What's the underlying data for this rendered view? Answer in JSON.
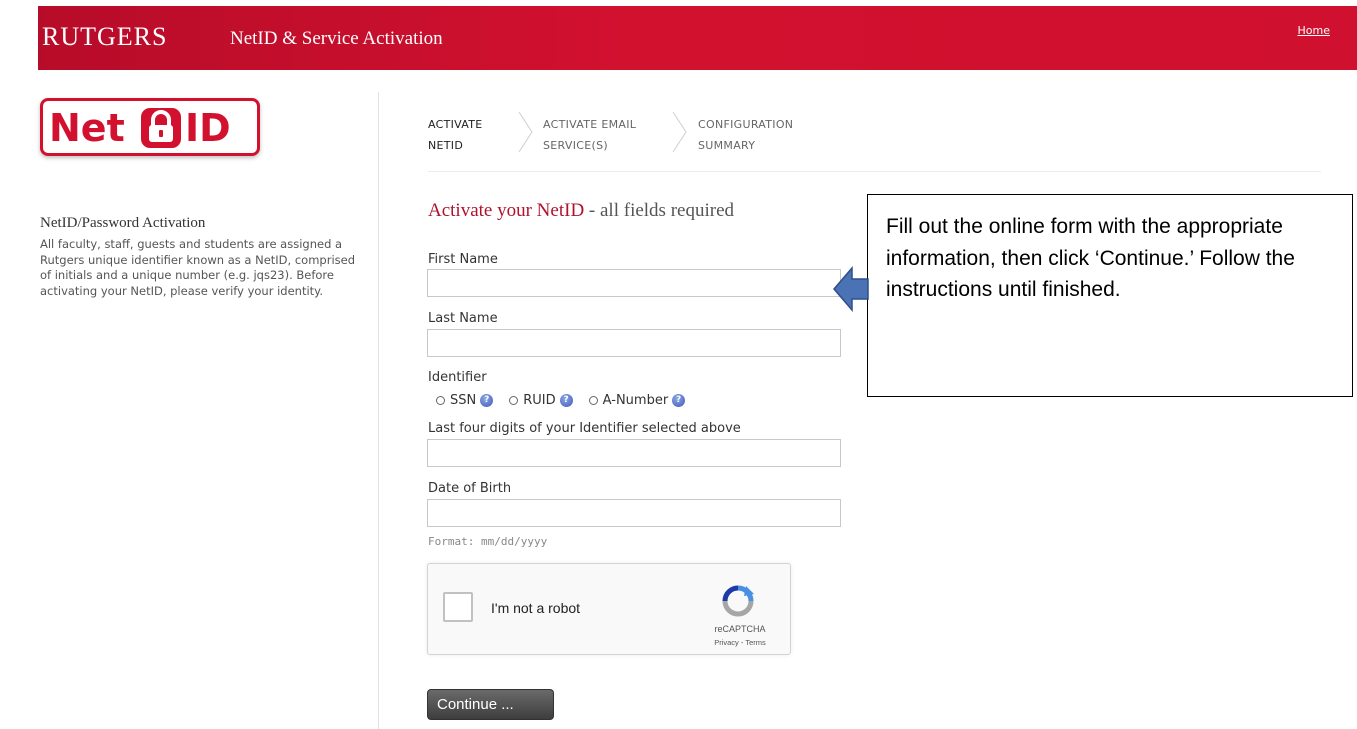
{
  "header": {
    "brand": "RUTGERS",
    "title": "NetID & Service Activation",
    "home_link": "Home"
  },
  "logo": {
    "text_left": "Net",
    "text_right": "ID"
  },
  "sidebar": {
    "title": "NetID/Password Activation",
    "description": "All faculty, staff, guests and students are assigned a Rutgers unique identifier known as a NetID, comprised of initials and a unique number (e.g. jqs23). Before activating your NetID, please verify your identity."
  },
  "steps": [
    {
      "line1": "ACTIVATE",
      "line2": "NETID"
    },
    {
      "line1": "ACTIVATE EMAIL",
      "line2": "SERVICE(S)"
    },
    {
      "line1": "CONFIGURATION",
      "line2": "SUMMARY"
    }
  ],
  "form": {
    "title": "Activate your NetID",
    "subtitle": " - all fields required",
    "first_name_label": "First Name",
    "first_name_value": "",
    "last_name_label": "Last Name",
    "last_name_value": "",
    "identifier_label": "Identifier",
    "identifier_options": [
      "SSN",
      "RUID",
      "A-Number"
    ],
    "last_four_label": "Last four digits of your Identifier selected above",
    "last_four_value": "",
    "dob_label": "Date of Birth",
    "dob_value": "",
    "dob_hint": "Format: mm/dd/yyyy",
    "continue_label": "Continue ..."
  },
  "captcha": {
    "label": "I'm not a robot",
    "brand": "reCAPTCHA",
    "links": "Privacy - Terms"
  },
  "callout": {
    "text": "Fill out the online form with the appropriate information, then click ‘Continue.’ Follow the instructions until finished."
  },
  "colors": {
    "header_red": "#cc0f2f",
    "title_red": "#b0122c",
    "arrow_blue": "#4a72b4"
  }
}
